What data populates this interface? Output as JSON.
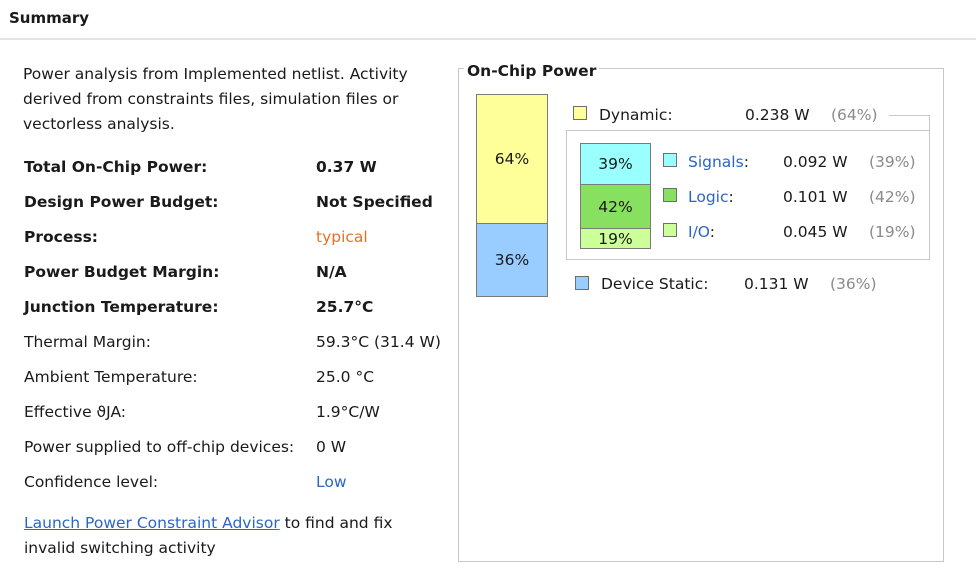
{
  "header": {
    "title": "Summary"
  },
  "description": "Power analysis from Implemented netlist. Activity derived from constraints files, simulation files or vectorless analysis.",
  "rows": [
    {
      "label": "Total On-Chip Power:",
      "value": "0.37 W"
    },
    {
      "label": "Design Power Budget:",
      "value": "Not Specified"
    },
    {
      "label": "Process:",
      "value": "typical"
    },
    {
      "label": "Power Budget Margin:",
      "value": "N/A"
    },
    {
      "label": "Junction Temperature:",
      "value": "25.7°C"
    },
    {
      "label": "Thermal Margin:",
      "value": "59.3°C (31.4 W)"
    },
    {
      "label": "Ambient Temperature:",
      "value": "25.0 °C"
    },
    {
      "label": "Effective ϑJA:",
      "value": "1.9°C/W"
    },
    {
      "label": "Power supplied to off-chip devices:",
      "value": "0 W"
    },
    {
      "label": "Confidence level:",
      "value": "Low"
    }
  ],
  "footer": {
    "link": "Launch Power Constraint Advisor",
    "text": " to find and fix invalid switching activity"
  },
  "onchip": {
    "title": "On-Chip Power",
    "dynamic": {
      "label": "Dynamic:",
      "value": "0.238 W",
      "pct": "(64%)",
      "bar_pct": "64%",
      "share": 0.64
    },
    "static": {
      "label": "Device Static:",
      "value": "0.131 W",
      "pct": "(36%)",
      "bar_pct": "36%",
      "share": 0.36
    },
    "breakdown": [
      {
        "label": "Signals",
        "colon": ":",
        "value": "0.092 W",
        "pct": "(39%)",
        "bar_pct": "39%",
        "share": 0.39
      },
      {
        "label": "Logic",
        "colon": ":",
        "value": "0.101 W",
        "pct": "(42%)",
        "bar_pct": "42%",
        "share": 0.42
      },
      {
        "label": "I/O",
        "colon": ":",
        "value": "0.045 W",
        "pct": "(19%)",
        "bar_pct": "19%",
        "share": 0.19
      }
    ],
    "colors": {
      "dynamic": "#ffff99",
      "static": "#99ccff",
      "signals": "#99ffff",
      "logic": "#88e060",
      "io": "#ccff99"
    }
  }
}
